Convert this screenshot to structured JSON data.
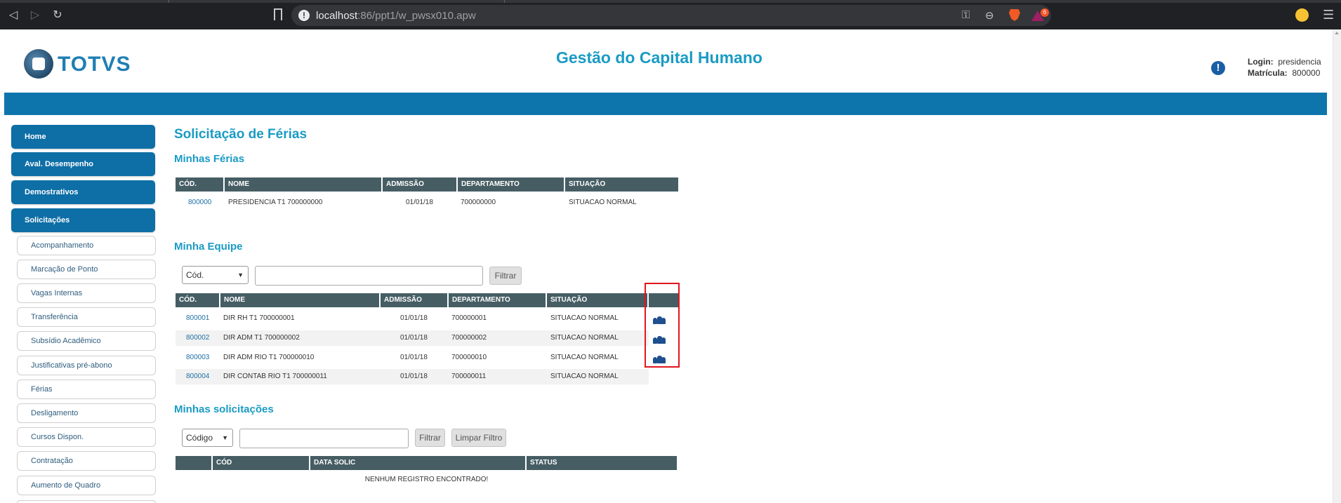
{
  "browser": {
    "url_host": "localhost",
    "url_rest": ":86/ppt1/w_pwsx010.apw",
    "rewards_count": "6"
  },
  "header": {
    "logo_text": "TOTVS",
    "title": "Gestão do Capital Humano",
    "login_label": "Login:",
    "login_value": "presidencia",
    "matricula_label": "Matrícula:",
    "matricula_value": "800000"
  },
  "sidebar": {
    "main_items": [
      {
        "label": "Home"
      },
      {
        "label": "Aval. Desempenho"
      },
      {
        "label": "Demostrativos"
      },
      {
        "label": "Solicitações"
      }
    ],
    "sub_items": [
      {
        "label": "Acompanhamento"
      },
      {
        "label": "Marcação de Ponto"
      },
      {
        "label": "Vagas Internas"
      },
      {
        "label": "Transferência"
      },
      {
        "label": "Subsídio Acadêmico"
      },
      {
        "label": "Justificativas pré-abono"
      },
      {
        "label": "Férias"
      },
      {
        "label": "Desligamento"
      },
      {
        "label": "Cursos Dispon."
      },
      {
        "label": "Contratação"
      },
      {
        "label": "Aumento de Quadro"
      }
    ]
  },
  "main": {
    "page_title": "Solicitação de Férias",
    "my_vacation": {
      "title": "Minhas Férias",
      "columns": [
        "CÓD.",
        "NOME",
        "ADMISSÃO",
        "DEPARTAMENTO",
        "SITUAÇÃO"
      ],
      "rows": [
        {
          "cod": "800000",
          "nome": "PRESIDENCIA T1 700000000",
          "admissao": "01/01/18",
          "departamento": "700000000",
          "situacao": "SITUACAO NORMAL"
        }
      ]
    },
    "my_team": {
      "title": "Minha Equipe",
      "filter_select": "Cód.",
      "filter_button": "Filtrar",
      "columns": [
        "CÓD.",
        "NOME",
        "ADMISSÃO",
        "DEPARTAMENTO",
        "SITUAÇÃO",
        ""
      ],
      "rows": [
        {
          "cod": "800001",
          "nome": "DIR RH T1 700000001",
          "admissao": "01/01/18",
          "departamento": "700000001",
          "situacao": "SITUACAO NORMAL",
          "has_team_icon": true
        },
        {
          "cod": "800002",
          "nome": "DIR ADM T1 700000002",
          "admissao": "01/01/18",
          "departamento": "700000002",
          "situacao": "SITUACAO NORMAL",
          "has_team_icon": true
        },
        {
          "cod": "800003",
          "nome": "DIR ADM RIO T1 700000010",
          "admissao": "01/01/18",
          "departamento": "700000010",
          "situacao": "SITUACAO NORMAL",
          "has_team_icon": true
        },
        {
          "cod": "800004",
          "nome": "DIR CONTAB RIO T1 700000011",
          "admissao": "01/01/18",
          "departamento": "700000011",
          "situacao": "SITUACAO NORMAL",
          "has_team_icon": false
        }
      ]
    },
    "my_requests": {
      "title": "Minhas solicitações",
      "filter_select": "Código",
      "filter_button": "Filtrar",
      "clear_button": "Limpar Filtro",
      "columns": [
        "",
        "CÓD",
        "DATA SOLIC",
        "STATUS"
      ],
      "empty_message": "NENHUM REGISTRO ENCONTRADO!"
    }
  },
  "colors": {
    "accent": "#1a9bc4",
    "nav_blue": "#0e6ea6",
    "table_header": "#465d64",
    "highlight": "#e3141e"
  }
}
